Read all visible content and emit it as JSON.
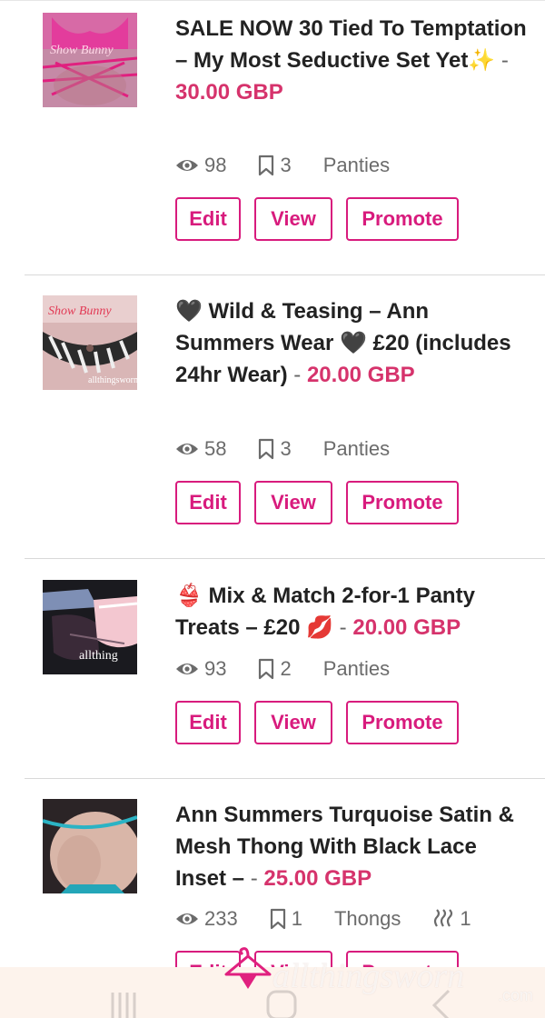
{
  "listings": [
    {
      "title": "SALE NOW 30 Tied To Temptation – My Most Seductive Set Yet✨",
      "separator": "-",
      "price": "30.00 GBP",
      "views": "98",
      "saves": "3",
      "category": "Panties",
      "thumb_caption": "Show Bunny",
      "buttons": {
        "edit": "Edit",
        "view": "View",
        "promote": "Promote"
      }
    },
    {
      "title": "🖤 Wild & Teasing – Ann Summers Wear 🖤 £20 (includes 24hr Wear)",
      "separator": "-",
      "price": "20.00 GBP",
      "views": "58",
      "saves": "3",
      "category": "Panties",
      "thumb_caption": "Show Bunny",
      "thumb_caption2": "allthingsworn",
      "buttons": {
        "edit": "Edit",
        "view": "View",
        "promote": "Promote"
      }
    },
    {
      "title": "👙 Mix & Match 2-for-1 Panty Treats – £20 💋",
      "separator": "-",
      "price": "20.00 GBP",
      "views": "93",
      "saves": "2",
      "category": "Panties",
      "thumb_caption": "allthing",
      "buttons": {
        "edit": "Edit",
        "view": "View",
        "promote": "Promote"
      }
    },
    {
      "title": "Ann Summers Turquoise Satin & Mesh Thong With Black Lace Inset –",
      "separator": "-",
      "price": "25.00 GBP",
      "views": "233",
      "saves": "1",
      "category": "Thongs",
      "wear_days": "1",
      "buttons": {
        "edit": "Edit",
        "view": "View",
        "promote": "Promote"
      }
    }
  ],
  "watermark": {
    "main": "allthingsworn",
    "suffix": ".com"
  },
  "colors": {
    "accent": "#d81b7d",
    "price": "#d6336c",
    "meta": "#6b6b6b"
  },
  "icons": [
    "eye-icon",
    "bookmark-icon",
    "steam-icon",
    "hanger-logo-icon",
    "recent-apps-icon",
    "home-icon",
    "back-icon"
  ]
}
